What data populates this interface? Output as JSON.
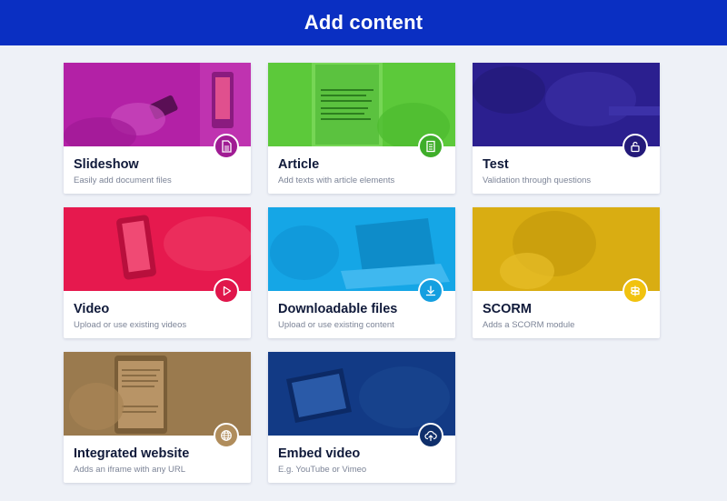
{
  "header": {
    "title": "Add content"
  },
  "cards": [
    {
      "title": "Slideshow",
      "subtitle": "Easily add document files",
      "color": "#b321a6",
      "badge_color": "#a01c94",
      "icon": "document-icon"
    },
    {
      "title": "Article",
      "subtitle": "Add texts with article elements",
      "color": "#5cc93a",
      "badge_color": "#3fae2a",
      "icon": "article-icon"
    },
    {
      "title": "Test",
      "subtitle": "Validation through questions",
      "color": "#2b1f8f",
      "badge_color": "#241a7a",
      "icon": "unlock-icon"
    },
    {
      "title": "Video",
      "subtitle": "Upload or use existing videos",
      "color": "#e6194e",
      "badge_color": "#e0164b",
      "icon": "play-icon"
    },
    {
      "title": "Downloadable files",
      "subtitle": "Upload or use existing content",
      "color": "#15a6e6",
      "badge_color": "#159fe0",
      "icon": "download-icon"
    },
    {
      "title": "SCORM",
      "subtitle": "Adds a SCORM module",
      "color": "#d9ad12",
      "badge_color": "#f1c20f",
      "icon": "signpost-icon"
    },
    {
      "title": "Integrated website",
      "subtitle": "Adds an iframe with any URL",
      "color": "#9a7a4e",
      "badge_color": "#b08d5c",
      "icon": "globe-icon"
    },
    {
      "title": "Embed video",
      "subtitle": "E.g. YouTube or Vimeo",
      "color": "#123a85",
      "badge_color": "#0f2f6b",
      "icon": "cloud-upload-icon"
    }
  ]
}
